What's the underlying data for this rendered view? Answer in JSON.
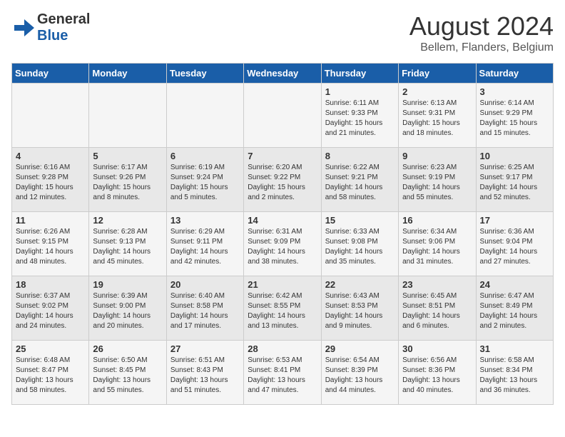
{
  "header": {
    "logo_general": "General",
    "logo_blue": "Blue",
    "title": "August 2024",
    "subtitle": "Bellem, Flanders, Belgium"
  },
  "weekdays": [
    "Sunday",
    "Monday",
    "Tuesday",
    "Wednesday",
    "Thursday",
    "Friday",
    "Saturday"
  ],
  "weeks": [
    [
      {
        "day": "",
        "info": ""
      },
      {
        "day": "",
        "info": ""
      },
      {
        "day": "",
        "info": ""
      },
      {
        "day": "",
        "info": ""
      },
      {
        "day": "1",
        "info": "Sunrise: 6:11 AM\nSunset: 9:33 PM\nDaylight: 15 hours and 21 minutes."
      },
      {
        "day": "2",
        "info": "Sunrise: 6:13 AM\nSunset: 9:31 PM\nDaylight: 15 hours and 18 minutes."
      },
      {
        "day": "3",
        "info": "Sunrise: 6:14 AM\nSunset: 9:29 PM\nDaylight: 15 hours and 15 minutes."
      }
    ],
    [
      {
        "day": "4",
        "info": "Sunrise: 6:16 AM\nSunset: 9:28 PM\nDaylight: 15 hours and 12 minutes."
      },
      {
        "day": "5",
        "info": "Sunrise: 6:17 AM\nSunset: 9:26 PM\nDaylight: 15 hours and 8 minutes."
      },
      {
        "day": "6",
        "info": "Sunrise: 6:19 AM\nSunset: 9:24 PM\nDaylight: 15 hours and 5 minutes."
      },
      {
        "day": "7",
        "info": "Sunrise: 6:20 AM\nSunset: 9:22 PM\nDaylight: 15 hours and 2 minutes."
      },
      {
        "day": "8",
        "info": "Sunrise: 6:22 AM\nSunset: 9:21 PM\nDaylight: 14 hours and 58 minutes."
      },
      {
        "day": "9",
        "info": "Sunrise: 6:23 AM\nSunset: 9:19 PM\nDaylight: 14 hours and 55 minutes."
      },
      {
        "day": "10",
        "info": "Sunrise: 6:25 AM\nSunset: 9:17 PM\nDaylight: 14 hours and 52 minutes."
      }
    ],
    [
      {
        "day": "11",
        "info": "Sunrise: 6:26 AM\nSunset: 9:15 PM\nDaylight: 14 hours and 48 minutes."
      },
      {
        "day": "12",
        "info": "Sunrise: 6:28 AM\nSunset: 9:13 PM\nDaylight: 14 hours and 45 minutes."
      },
      {
        "day": "13",
        "info": "Sunrise: 6:29 AM\nSunset: 9:11 PM\nDaylight: 14 hours and 42 minutes."
      },
      {
        "day": "14",
        "info": "Sunrise: 6:31 AM\nSunset: 9:09 PM\nDaylight: 14 hours and 38 minutes."
      },
      {
        "day": "15",
        "info": "Sunrise: 6:33 AM\nSunset: 9:08 PM\nDaylight: 14 hours and 35 minutes."
      },
      {
        "day": "16",
        "info": "Sunrise: 6:34 AM\nSunset: 9:06 PM\nDaylight: 14 hours and 31 minutes."
      },
      {
        "day": "17",
        "info": "Sunrise: 6:36 AM\nSunset: 9:04 PM\nDaylight: 14 hours and 27 minutes."
      }
    ],
    [
      {
        "day": "18",
        "info": "Sunrise: 6:37 AM\nSunset: 9:02 PM\nDaylight: 14 hours and 24 minutes."
      },
      {
        "day": "19",
        "info": "Sunrise: 6:39 AM\nSunset: 9:00 PM\nDaylight: 14 hours and 20 minutes."
      },
      {
        "day": "20",
        "info": "Sunrise: 6:40 AM\nSunset: 8:58 PM\nDaylight: 14 hours and 17 minutes."
      },
      {
        "day": "21",
        "info": "Sunrise: 6:42 AM\nSunset: 8:55 PM\nDaylight: 14 hours and 13 minutes."
      },
      {
        "day": "22",
        "info": "Sunrise: 6:43 AM\nSunset: 8:53 PM\nDaylight: 14 hours and 9 minutes."
      },
      {
        "day": "23",
        "info": "Sunrise: 6:45 AM\nSunset: 8:51 PM\nDaylight: 14 hours and 6 minutes."
      },
      {
        "day": "24",
        "info": "Sunrise: 6:47 AM\nSunset: 8:49 PM\nDaylight: 14 hours and 2 minutes."
      }
    ],
    [
      {
        "day": "25",
        "info": "Sunrise: 6:48 AM\nSunset: 8:47 PM\nDaylight: 13 hours and 58 minutes."
      },
      {
        "day": "26",
        "info": "Sunrise: 6:50 AM\nSunset: 8:45 PM\nDaylight: 13 hours and 55 minutes."
      },
      {
        "day": "27",
        "info": "Sunrise: 6:51 AM\nSunset: 8:43 PM\nDaylight: 13 hours and 51 minutes."
      },
      {
        "day": "28",
        "info": "Sunrise: 6:53 AM\nSunset: 8:41 PM\nDaylight: 13 hours and 47 minutes."
      },
      {
        "day": "29",
        "info": "Sunrise: 6:54 AM\nSunset: 8:39 PM\nDaylight: 13 hours and 44 minutes."
      },
      {
        "day": "30",
        "info": "Sunrise: 6:56 AM\nSunset: 8:36 PM\nDaylight: 13 hours and 40 minutes."
      },
      {
        "day": "31",
        "info": "Sunrise: 6:58 AM\nSunset: 8:34 PM\nDaylight: 13 hours and 36 minutes."
      }
    ]
  ]
}
